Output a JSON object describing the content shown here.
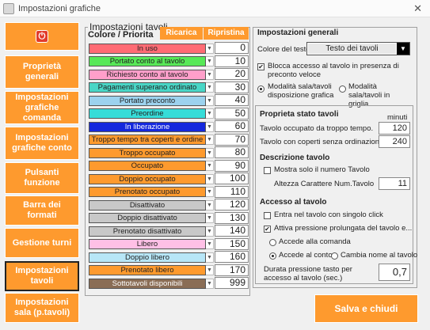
{
  "window": {
    "title": "Impostazioni grafiche",
    "close": "✕"
  },
  "nav": [
    {
      "label": "Proprietà\ngenerali",
      "name": "nav-proprieta-generali"
    },
    {
      "label": "Impostazioni\ngrafiche\ncomanda",
      "name": "nav-grafiche-comanda"
    },
    {
      "label": "Impostazioni\ngrafiche conto",
      "name": "nav-grafiche-conto"
    },
    {
      "label": "Pulsanti\nfunzione",
      "name": "nav-pulsanti-funzione"
    },
    {
      "label": "Barra dei formati",
      "name": "nav-barra-formati"
    },
    {
      "label": "Gestione turni",
      "name": "nav-gestione-turni"
    },
    {
      "label": "Impostazioni\ntavoli",
      "name": "nav-impostazioni-tavoli",
      "active": true
    },
    {
      "label": "Impostazioni\nsala (p.tavoli)",
      "name": "nav-impostazioni-sala"
    }
  ],
  "tables_group": {
    "title": "Impostazioni tavoli",
    "header": "Colore / Priorita",
    "ricarica": "Ricarica",
    "ripristina": "Ripristina"
  },
  "colors": {
    "accent": "#fe9a2e"
  },
  "status_rows": [
    {
      "label": "In uso",
      "bg": "#ff6b74",
      "fg": "#222",
      "value": "0"
    },
    {
      "label": "Portato conto al tavolo",
      "bg": "#57e857",
      "fg": "#222",
      "value": "10"
    },
    {
      "label": "Richiesto conto al tavolo",
      "bg": "#ff9fca",
      "fg": "#222",
      "value": "20"
    },
    {
      "label": "Pagamenti superano ordinato",
      "bg": "#49d6c6",
      "fg": "#222",
      "value": "30"
    },
    {
      "label": "Portato preconto",
      "bg": "#9cd2ee",
      "fg": "#222",
      "value": "40"
    },
    {
      "label": "Preordine",
      "bg": "#36dcd8",
      "fg": "#222",
      "value": "50"
    },
    {
      "label": "In liberazione",
      "bg": "#1428dd",
      "fg": "#ffffff",
      "value": "60"
    },
    {
      "label": "Troppo tempo tra coperti e ordine",
      "bg": "#fe9a2e",
      "fg": "#222",
      "value": "70"
    },
    {
      "label": "Troppo occupato",
      "bg": "#fe9a2e",
      "fg": "#222",
      "value": "80"
    },
    {
      "label": "Occupato",
      "bg": "#fe9a2e",
      "fg": "#222",
      "value": "90"
    },
    {
      "label": "Doppio occupato",
      "bg": "#fe9a2e",
      "fg": "#222",
      "value": "100"
    },
    {
      "label": "Prenotato occupato",
      "bg": "#fe9a2e",
      "fg": "#222",
      "value": "110"
    },
    {
      "label": "Disattivato",
      "bg": "#c8c8c8",
      "fg": "#222",
      "value": "120"
    },
    {
      "label": "Doppio disattivato",
      "bg": "#c8c8c8",
      "fg": "#222",
      "value": "130"
    },
    {
      "label": "Prenotato disattivato",
      "bg": "#c8c8c8",
      "fg": "#222",
      "value": "140"
    },
    {
      "label": "Libero",
      "bg": "#ffc0e6",
      "fg": "#222",
      "value": "150"
    },
    {
      "label": "Doppio libero",
      "bg": "#b7e6f7",
      "fg": "#222",
      "value": "160"
    },
    {
      "label": "Prenotato libero",
      "bg": "#fe9a2e",
      "fg": "#222",
      "value": "170"
    },
    {
      "label": "Sottotavoli disponibili",
      "bg": "#8a6d55",
      "fg": "#ffffff",
      "value": "999"
    }
  ],
  "general": {
    "title": "Impostazioni generali",
    "text_color_label": "Colore del testo",
    "text_color_value": "Testo dei tavoli",
    "block_access": "Blocca accesso al tavolo in presenza di preconto veloce",
    "mode_graphic": "Modalità sala/tavoli disposizione grafica",
    "mode_grid": "Modalità sala/tavoli in griglia"
  },
  "table_state": {
    "title": "Proprieta stato tavoli",
    "minutes": "minuti",
    "occupied_label": "Tavolo occupato da troppo tempo.",
    "occupied_value": "120",
    "covers_label": "Tavolo con coperti senza ordinazioni:",
    "covers_value": "240"
  },
  "table_desc": {
    "title": "Descrizione tavolo",
    "show_number": "Mostra solo il numero Tavolo",
    "height_label": "Altezza Carattere Num.Tavolo",
    "height_value": "11"
  },
  "access": {
    "title": "Accesso al tavolo",
    "single_click": "Entra nel tavolo con singolo click",
    "long_press": "Attiva pressione prolungata del tavolo e...",
    "opt_comanda": "Accede alla comanda",
    "opt_conto": "Accede al conto",
    "opt_rename": "Cambia nome al tavolo",
    "duration_label": "Durata pressione tasto per accesso al tavolo (sec.)",
    "duration_value": "0,7"
  },
  "save_label": "Salva e chiudi"
}
